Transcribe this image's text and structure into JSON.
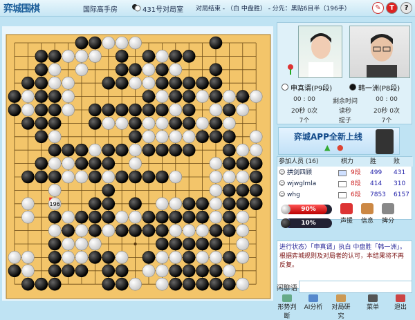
{
  "titlebar": {
    "logo": "弈城围棋",
    "room_name": "国际高手房",
    "table": "431号对局室",
    "status": "对局结束 - （白 中盘胜） - 分先：黑贴6目半（196手）",
    "help_label": "?",
    "turn_label": "T"
  },
  "players": {
    "white": {
      "name": "申真谞",
      "rank": "(P9段)",
      "time": "00 : 00",
      "byoyomi": "20秒 0次",
      "moves": "7个"
    },
    "black": {
      "name": "韩一洲",
      "rank": "(P8段)",
      "time": "00 : 00",
      "byoyomi": "20秒 0次",
      "moves": "7个"
    },
    "center_labels": {
      "remaining": "剩余时间",
      "byoyomi": "读秒",
      "bonus": "提子"
    }
  },
  "ad": {
    "text": "弈城APP全新上线"
  },
  "members": {
    "headers": {
      "name": "参加人员 (16)",
      "rank": "棋力",
      "win": "胜",
      "loss": "败"
    },
    "rows": [
      {
        "name": "拱剑四顾",
        "rank": "9段",
        "win": "499",
        "loss": "431",
        "flag_color": "#cfe0ff"
      },
      {
        "name": "wjwglmla",
        "rank": "8段",
        "win": "414",
        "loss": "310",
        "flag_color": "#ffffff"
      },
      {
        "name": "whg",
        "rank": "6段",
        "win": "7853",
        "loss": "6157",
        "flag_color": "#ffffff"
      }
    ]
  },
  "eval": {
    "white_pct": 90,
    "black_pct": 10,
    "white_label": "90%",
    "black_label": "10%"
  },
  "actions": [
    {
      "label": "声援",
      "icon": "cheer-icon",
      "color": "#d33"
    },
    {
      "label": "信息",
      "icon": "info-icon",
      "color": "#c84"
    },
    {
      "label": "捭分",
      "icon": "score-icon",
      "color": "#888"
    }
  ],
  "chat": {
    "line1": "进行状态〉「申真谞」执白 中盘胜「韩一洲」。",
    "line2": "根据弈城规则及对局者的认可，本结果将不再反复。",
    "label": "闲聊语",
    "placeholder": ""
  },
  "bottom": [
    {
      "label": "形势判断",
      "icon": "judge-icon"
    },
    {
      "label": "AI分析",
      "icon": "ai-icon"
    },
    {
      "label": "对局研究",
      "icon": "study-icon"
    },
    {
      "label": "菜单",
      "icon": "menu-icon"
    },
    {
      "label": "退出",
      "icon": "exit-icon"
    }
  ],
  "board": {
    "size": 19,
    "last_move_label": "196",
    "last_move": [
      3,
      12
    ],
    "rows": [
      ".....bbwww.....b...",
      "..bbwww.b.bwbb.....",
      "..bw.w..bbwbw..b...",
      ".bbww..bbwwbbbbb...",
      "bwbbw.....bwbbwbwbw",
      "bwbbw.bbbbbbwb.wbw.",
      ".bbb..bwwbwwbbwbw..",
      "..bw.....bwwwwbbb.w",
      "...bbbwbbwbbbb..bww",
      "..bwwbbb.w.....wbbb",
      ".bbbwwbwbbbbw..wwwb",
      "...w...b.......wbbb",
      ".w.W..bb.b.wwbbwbbb",
      ".w.bwbbbwwbbbbbwbw.",
      "...wbwbwbbbbwwwbbw.",
      "...bwww....bbbbb.w.",
      "ww.bwwbbw.bwwbwwbw.",
      "bw.bbb.bb.wwbbbbw..",
      ".bbb...bbw.wbbbbbw."
    ]
  }
}
